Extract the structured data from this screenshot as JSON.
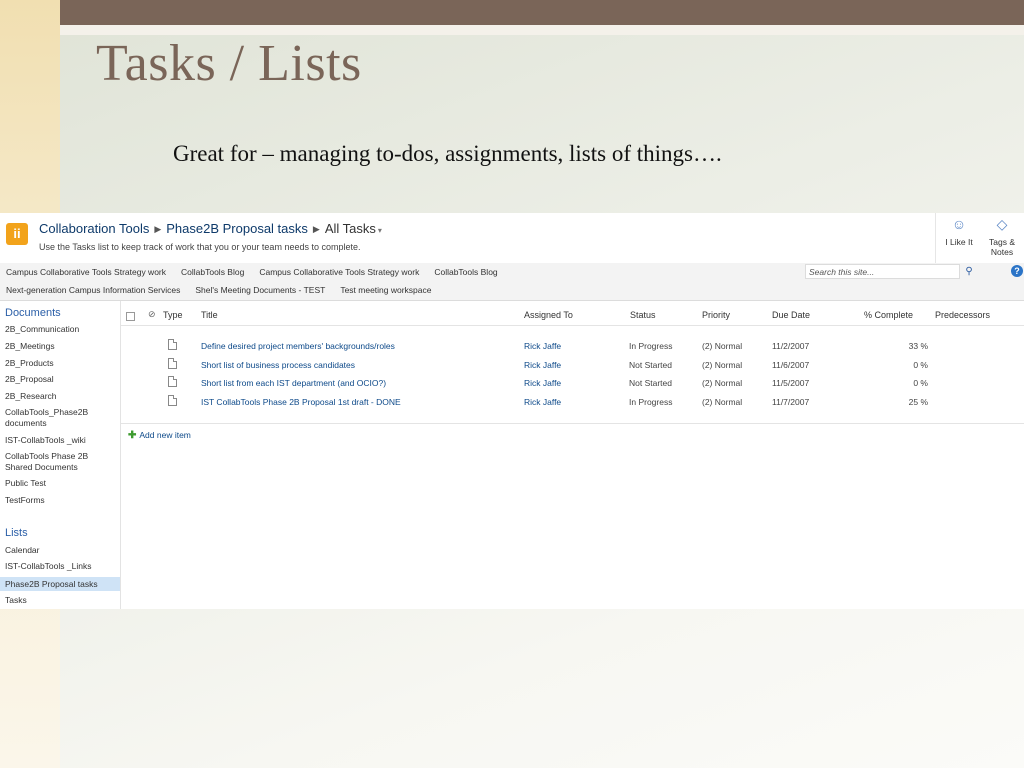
{
  "slide": {
    "title": "Tasks / Lists",
    "subtitle": "Great for – managing to-dos, assignments, lists of things…."
  },
  "sharepoint": {
    "breadcrumb": [
      "Collaboration Tools",
      "Phase2B Proposal tasks",
      "All Tasks"
    ],
    "description": "Use the Tasks list to keep track of work that you or your team needs to complete.",
    "actions": {
      "like": "I Like It",
      "tags_line1": "Tags &",
      "tags_line2": "Notes"
    },
    "top_nav_row1": [
      "Campus Collaborative Tools Strategy work",
      "CollabTools Blog",
      "Campus Collaborative Tools Strategy work",
      "CollabTools Blog"
    ],
    "top_nav_row2": [
      "Next-generation Campus Information Services",
      "Shel's Meeting Documents - TEST",
      "Test meeting workspace"
    ],
    "search_placeholder": "Search this site...",
    "quick_launch": {
      "documents_heading": "Documents",
      "documents": [
        "2B_Communication",
        "2B_Meetings",
        "2B_Products",
        "2B_Proposal",
        "2B_Research",
        "CollabTools_Phase2B documents",
        "IST-CollabTools _wiki",
        "CollabTools Phase 2B Shared Documents",
        "Public Test",
        "TestForms"
      ],
      "lists_heading": "Lists",
      "lists": [
        "Calendar",
        "IST-CollabTools _Links",
        "Phase2B Proposal tasks",
        "Tasks"
      ]
    },
    "columns": [
      "Type",
      "Title",
      "Assigned To",
      "Status",
      "Priority",
      "Due Date",
      "% Complete",
      "Predecessors"
    ],
    "tasks": [
      {
        "title": "Define desired project members' backgrounds/roles",
        "assigned": "Rick Jaffe",
        "status": "In Progress",
        "priority": "(2) Normal",
        "due": "11/2/2007",
        "complete": "33 %"
      },
      {
        "title": "Short list of business process candidates",
        "assigned": "Rick Jaffe",
        "status": "Not Started",
        "priority": "(2) Normal",
        "due": "11/6/2007",
        "complete": "0 %"
      },
      {
        "title": "Short list from each IST department (and OCIO?)",
        "assigned": "Rick Jaffe",
        "status": "Not Started",
        "priority": "(2) Normal",
        "due": "11/5/2007",
        "complete": "0 %"
      },
      {
        "title": "IST CollabTools Phase 2B Proposal 1st draft - DONE",
        "assigned": "Rick Jaffe",
        "status": "In Progress",
        "priority": "(2) Normal",
        "due": "11/7/2007",
        "complete": "25 %"
      }
    ],
    "add_new": "Add new item"
  }
}
